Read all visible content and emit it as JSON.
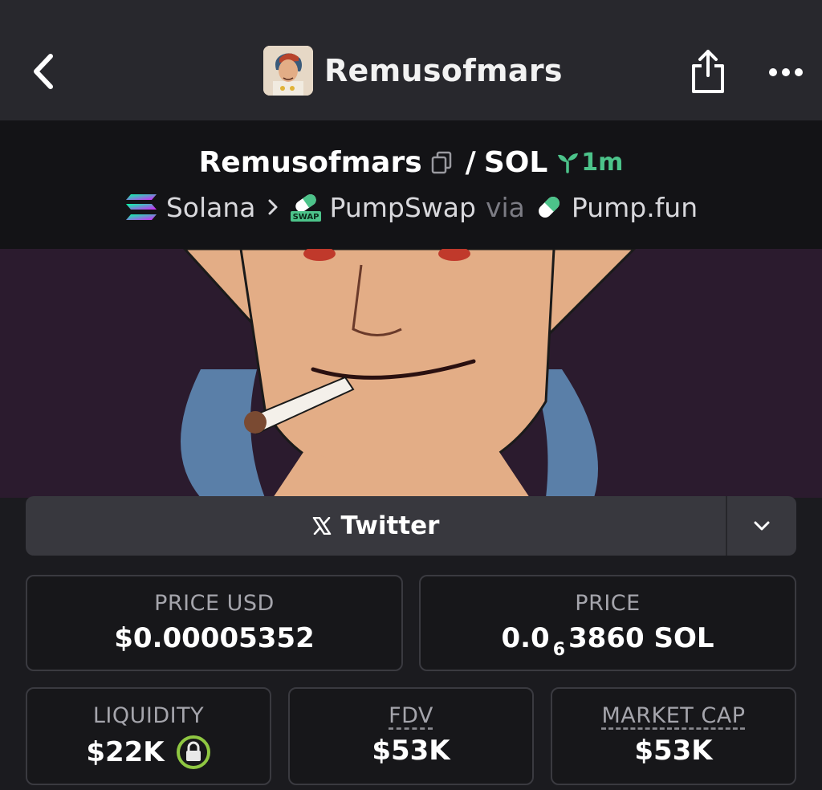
{
  "header": {
    "title": "Remusofmars",
    "back_icon": "chevron-left-icon",
    "share_icon": "share-icon",
    "more_icon": "more-horizontal-icon"
  },
  "pair": {
    "base": "Remusofmars",
    "separator": "/",
    "quote": "SOL",
    "age": "1m",
    "chain": "Solana",
    "dex": "PumpSwap",
    "via": "via",
    "launchpad": "Pump.fun"
  },
  "social": {
    "twitter_label": "Twitter"
  },
  "stats": {
    "price_usd_label": "PRICE USD",
    "price_usd_value": "$0.00005352",
    "price_label": "PRICE",
    "price_value_prefix": "0.0",
    "price_value_zeros": "6",
    "price_value_suffix": "3860 SOL",
    "liquidity_label": "LIQUIDITY",
    "liquidity_value": "$22K",
    "fdv_label": "FDV",
    "fdv_value": "$53K",
    "market_cap_label": "MARKET CAP",
    "market_cap_value": "$53K"
  },
  "colors": {
    "accent_green": "#4cc38a",
    "lock_green": "#8fc742"
  }
}
